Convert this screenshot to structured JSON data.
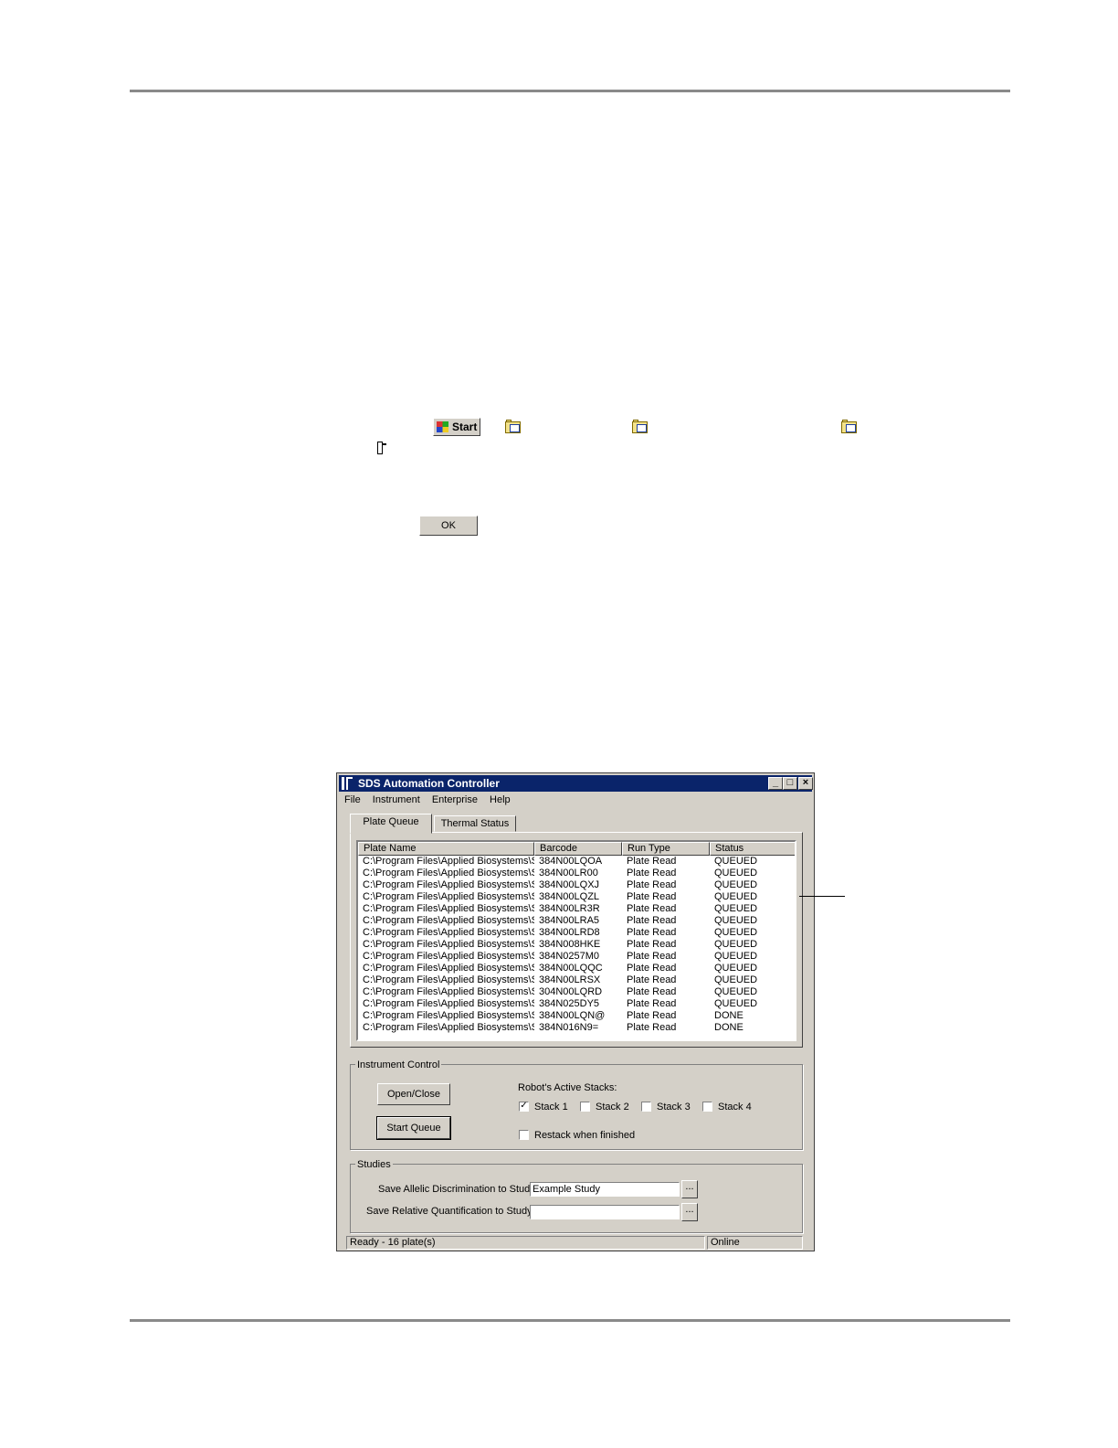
{
  "doc": {
    "start_label": "Start",
    "ok_label": "OK"
  },
  "window": {
    "title": "SDS Automation Controller",
    "controls": {
      "minimize": "_",
      "maximize": "□",
      "close": "×"
    },
    "menu": [
      "File",
      "Instrument",
      "Enterprise",
      "Help"
    ],
    "tabs": [
      "Plate Queue",
      "Thermal Status"
    ],
    "active_tab": "Plate Queue",
    "queue": {
      "columns": [
        "Plate Name",
        "Barcode",
        "Run Type",
        "Status"
      ],
      "rows": [
        [
          "C:\\Program Files\\Applied Biosystems\\S...",
          "384N00LQOA",
          "Plate Read",
          "QUEUED"
        ],
        [
          "C:\\Program Files\\Applied Biosystems\\S...",
          "384N00LR00",
          "Plate Read",
          "QUEUED"
        ],
        [
          "C:\\Program Files\\Applied Biosystems\\S...",
          "384N00LQXJ",
          "Plate Read",
          "QUEUED"
        ],
        [
          "C:\\Program Files\\Applied Biosystems\\S...",
          "384N00LQZL",
          "Plate Read",
          "QUEUED"
        ],
        [
          "C:\\Program Files\\Applied Biosystems\\S...",
          "384N00LR3R",
          "Plate Read",
          "QUEUED"
        ],
        [
          "C:\\Program Files\\Applied Biosystems\\S...",
          "384N00LRA5",
          "Plate Read",
          "QUEUED"
        ],
        [
          "C:\\Program Files\\Applied Biosystems\\S...",
          "384N00LRD8",
          "Plate Read",
          "QUEUED"
        ],
        [
          "C:\\Program Files\\Applied Biosystems\\S...",
          "384N008HKE",
          "Plate Read",
          "QUEUED"
        ],
        [
          "C:\\Program Files\\Applied Biosystems\\S...",
          "384N0257M0",
          "Plate Read",
          "QUEUED"
        ],
        [
          "C:\\Program Files\\Applied Biosystems\\S...",
          "384N00LQQC",
          "Plate Read",
          "QUEUED"
        ],
        [
          "C:\\Program Files\\Applied Biosystems\\S...",
          "384N00LRSX",
          "Plate Read",
          "QUEUED"
        ],
        [
          "C:\\Program Files\\Applied Biosystems\\S...",
          "304N00LQRD",
          "Plate Read",
          "QUEUED"
        ],
        [
          "C:\\Program Files\\Applied Biosystems\\S...",
          "384N025DY5",
          "Plate Read",
          "QUEUED"
        ],
        [
          "C:\\Program Files\\Applied Biosystems\\S...",
          "384N00LQN@",
          "Plate Read",
          "DONE"
        ],
        [
          "C:\\Program Files\\Applied Biosystems\\S...",
          "384N016N9=",
          "Plate Read",
          "DONE"
        ]
      ]
    },
    "instrument_control": {
      "label": "Instrument Control",
      "open_close": "Open/Close",
      "start_queue": "Start Queue",
      "stacks_label": "Robot's Active Stacks:",
      "stacks": [
        {
          "label": "Stack 1",
          "checked": true
        },
        {
          "label": "Stack 2",
          "checked": false
        },
        {
          "label": "Stack 3",
          "checked": false
        },
        {
          "label": "Stack 4",
          "checked": false
        }
      ],
      "restack_label": "Restack when finished",
      "restack_checked": false
    },
    "studies": {
      "label": "Studies",
      "allelic_label": "Save Allelic Discrimination to Study:",
      "allelic_value": "Example Study",
      "relative_label": "Save Relative Quantification to Study:",
      "relative_value": "",
      "browse_label": "..."
    },
    "status": {
      "message": "Ready - 16 plate(s)",
      "connection": "Online"
    }
  }
}
